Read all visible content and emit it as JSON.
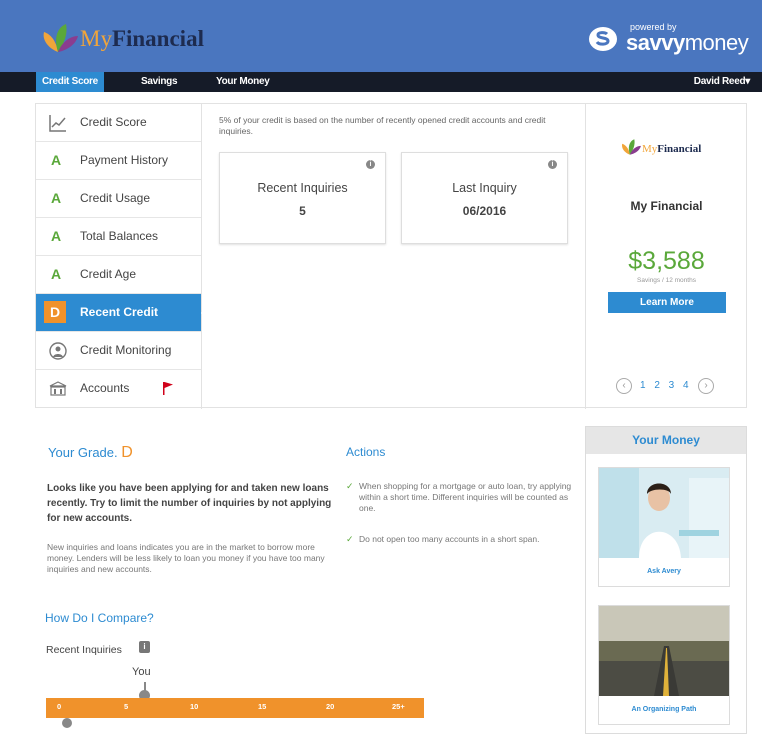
{
  "brand": {
    "my": "My",
    "financial": "Financial",
    "powered_by": "powered by",
    "provider_savvy": "savvy",
    "provider_money": "money"
  },
  "nav": {
    "items": [
      {
        "label": "Credit Score"
      },
      {
        "label": "Savings"
      },
      {
        "label": "Your Money"
      }
    ],
    "user": "David Reed"
  },
  "sidebar": {
    "items": [
      {
        "label": "Credit Score",
        "grade": ""
      },
      {
        "label": "Payment History",
        "grade": "A"
      },
      {
        "label": "Credit Usage",
        "grade": "A"
      },
      {
        "label": "Total Balances",
        "grade": "A"
      },
      {
        "label": "Credit Age",
        "grade": "A"
      },
      {
        "label": "Recent Credit",
        "grade": "D"
      },
      {
        "label": "Credit Monitoring",
        "grade": ""
      },
      {
        "label": "Accounts",
        "grade": ""
      }
    ]
  },
  "detail": {
    "intro": "5% of your credit is based on the number of recently opened credit accounts and credit inquiries.",
    "cards": [
      {
        "title": "Recent Inquiries",
        "value": "5"
      },
      {
        "title": "Last Inquiry",
        "value": "06/2016"
      }
    ]
  },
  "promo": {
    "logo_my": "My",
    "logo_financial": "Financial",
    "name": "My Financial",
    "amount": "$3,588",
    "amount_sub": "Savings / 12 months",
    "button": "Learn More",
    "pages": "1 2 3 4",
    "prev": "‹",
    "next": "›"
  },
  "grade": {
    "label": "Your Grade.",
    "letter": "D",
    "main_desc": "Looks like you have been applying for and taken new loans recently. Try to limit the number of inquiries by not applying for new accounts.",
    "sub_desc": "New inquiries and loans indicates you are in the market to borrow more money. Lenders will be less likely to loan you money if you have too many inquiries and new accounts."
  },
  "actions": {
    "heading": "Actions",
    "items": [
      "When shopping for a mortgage or auto loan, try applying within a short time. Different inquiries will be counted as one.",
      "Do not open too many accounts in a short span."
    ]
  },
  "compare": {
    "heading": "How Do I Compare?",
    "metric": "Recent Inquiries",
    "info": "i",
    "you": "You",
    "ticks": [
      "0",
      "5",
      "10",
      "15",
      "20",
      "25+"
    ],
    "you_value": 5
  },
  "your_money": {
    "heading": "Your Money",
    "articles": [
      {
        "caption": "Ask Avery"
      },
      {
        "caption": "An Organizing Path"
      }
    ]
  },
  "colors": {
    "header_blue": "#4a76bf",
    "accent_blue": "#2d8bd1",
    "grade_green": "#5aa83a",
    "grade_orange": "#f0922b",
    "nav_dark": "#151b28"
  }
}
